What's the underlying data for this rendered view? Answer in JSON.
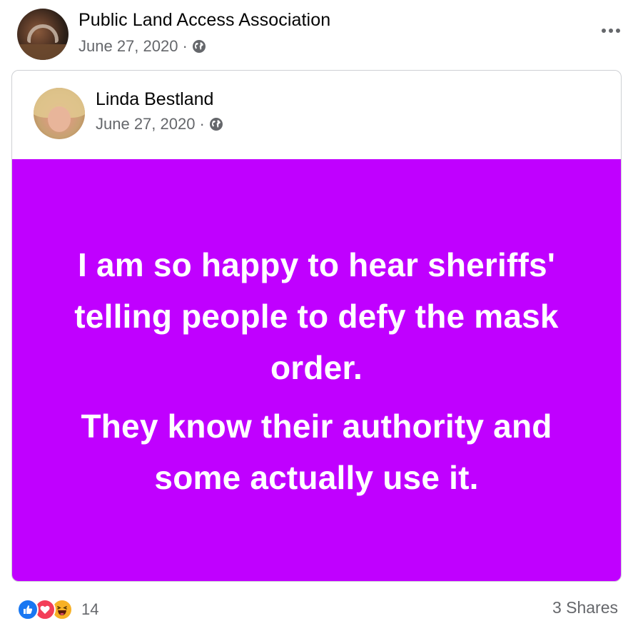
{
  "post": {
    "page_name": "Public Land Access Association",
    "date": "June 27, 2020",
    "separator": "·",
    "privacy_icon": "globe-icon",
    "more_icon": "more-options-icon"
  },
  "shared_post": {
    "author_name": "Linda Bestland",
    "date": "June 27, 2020",
    "separator": "·",
    "privacy_icon": "globe-icon",
    "background_color": "#c000ff",
    "status_paragraphs": [
      "I am so happy to hear sheriffs' telling people to defy the mask order.",
      "They know their authority and some actually use it."
    ]
  },
  "footer": {
    "reaction_icons": [
      "like-icon",
      "love-icon",
      "haha-icon"
    ],
    "reaction_count": "14",
    "shares_label": "3 Shares"
  }
}
